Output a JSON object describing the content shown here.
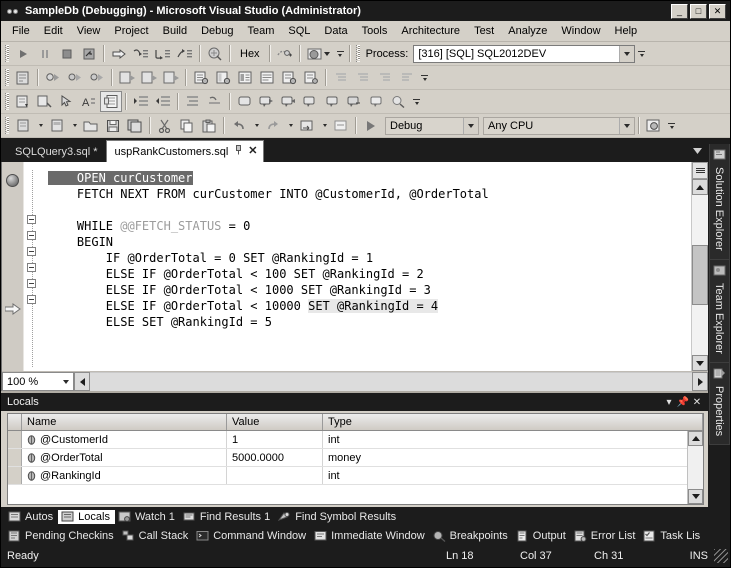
{
  "window": {
    "title": "SampleDb (Debugging) - Microsoft Visual Studio (Administrator)",
    "logo_icon": "vs-logo-icon",
    "minimize_label": "_",
    "maximize_label": "□",
    "close_label": "✕"
  },
  "menu": {
    "items": [
      {
        "label": "File"
      },
      {
        "label": "Edit"
      },
      {
        "label": "View"
      },
      {
        "label": "Project"
      },
      {
        "label": "Build"
      },
      {
        "label": "Debug"
      },
      {
        "label": "Team"
      },
      {
        "label": "SQL"
      },
      {
        "label": "Data"
      },
      {
        "label": "Tools"
      },
      {
        "label": "Architecture"
      },
      {
        "label": "Test"
      },
      {
        "label": "Analyze"
      },
      {
        "label": "Window"
      },
      {
        "label": "Help"
      }
    ]
  },
  "toolbars": {
    "debug": {
      "buttons": [
        {
          "name": "continue-button",
          "icon": "play-icon"
        },
        {
          "name": "break-all-button",
          "icon": "pause-icon"
        },
        {
          "name": "stop-debugging-button",
          "icon": "stop-icon"
        },
        {
          "name": "restart-button",
          "icon": "restart-icon"
        },
        {
          "name": "show-next-statement-button",
          "icon": "arrow-right-icon"
        },
        {
          "name": "step-into-button",
          "icon": "step-into-icon"
        },
        {
          "name": "step-over-button",
          "icon": "step-over-icon"
        },
        {
          "name": "step-out-button",
          "icon": "step-out-icon"
        },
        {
          "name": "breakpoints-window-button",
          "icon": "breakpoint-window-icon"
        }
      ],
      "hex_label": "Hex",
      "thread_icon": "thread-icon",
      "process_label": "Process:",
      "process_value": "[316] [SQL] SQL2012DEV"
    },
    "standard": {
      "config_value": "Debug",
      "platform_value": "Any CPU",
      "start_icon": "start-debug-icon"
    },
    "zoom_value": "100 %"
  },
  "doc_tabs": [
    {
      "label": "SQLQuery3.sql *",
      "active": false,
      "name": "tab-sqlquery3"
    },
    {
      "label": "uspRankCustomers.sql",
      "active": true,
      "name": "tab-usprankcustomers",
      "pin_icon": "pin-icon",
      "close_icon": "close-icon"
    }
  ],
  "editor": {
    "lines": [
      {
        "indent": 4,
        "segments": [
          {
            "text": "OPEN curCustomer",
            "style": "sel"
          }
        ]
      },
      {
        "indent": 4,
        "segments": [
          {
            "text": "FETCH NEXT FROM curCustomer INTO @CustomerId, @OrderTotal",
            "style": "plain"
          }
        ]
      },
      {
        "indent": 0,
        "segments": [
          {
            "text": "",
            "style": "plain"
          }
        ]
      },
      {
        "indent": 4,
        "segments": [
          {
            "text": "WHILE ",
            "style": "plain"
          },
          {
            "text": "@@FETCH_STATUS",
            "style": "sys"
          },
          {
            "text": " = 0",
            "style": "plain"
          }
        ]
      },
      {
        "indent": 4,
        "segments": [
          {
            "text": "BEGIN",
            "style": "plain"
          }
        ]
      },
      {
        "indent": 8,
        "segments": [
          {
            "text": "IF @OrderTotal = 0 SET @RankingId = 1",
            "style": "plain"
          }
        ]
      },
      {
        "indent": 8,
        "segments": [
          {
            "text": "ELSE IF @OrderTotal < 100 SET @RankingId = 2",
            "style": "plain"
          }
        ]
      },
      {
        "indent": 8,
        "segments": [
          {
            "text": "ELSE IF @OrderTotal < 1000 SET @RankingId = 3",
            "style": "plain"
          }
        ]
      },
      {
        "indent": 8,
        "segments": [
          {
            "text": "ELSE IF @OrderTotal < 10000 ",
            "style": "plain"
          },
          {
            "text": "SET @RankingId = 4",
            "style": "hl"
          }
        ]
      },
      {
        "indent": 8,
        "segments": [
          {
            "text": "ELSE SET @RankingId = 5",
            "style": "plain"
          }
        ]
      }
    ],
    "breakpoint_icon": "breakpoint-icon",
    "current_statement_icon": "current-statement-arrow-icon"
  },
  "right_tabs": [
    {
      "label": "Solution Explorer",
      "icon": "solution-explorer-icon",
      "name": "vtab-solution-explorer"
    },
    {
      "label": "Team Explorer",
      "icon": "team-explorer-icon",
      "name": "vtab-team-explorer"
    },
    {
      "label": "Properties",
      "icon": "properties-icon",
      "name": "vtab-properties"
    }
  ],
  "locals": {
    "title": "Locals",
    "dropdown_icon": "chevron-down-icon",
    "pin_icon": "pin-icon",
    "close_icon": "close-icon",
    "columns": [
      "Name",
      "Value",
      "Type"
    ],
    "rows": [
      {
        "name": "@CustomerId",
        "value": "1",
        "type": "int"
      },
      {
        "name": "@OrderTotal",
        "value": "5000.0000",
        "type": "money"
      },
      {
        "name": "@RankingId",
        "value": "",
        "type": "int"
      }
    ]
  },
  "bottom_tabs_upper": [
    {
      "label": "Autos",
      "icon": "autos-icon",
      "active": false,
      "name": "tab-autos"
    },
    {
      "label": "Locals",
      "icon": "locals-icon",
      "active": true,
      "name": "tab-locals"
    },
    {
      "label": "Watch 1",
      "icon": "watch-icon",
      "active": false,
      "name": "tab-watch-1"
    },
    {
      "label": "Find Results 1",
      "icon": "find-results-icon",
      "active": false,
      "name": "tab-find-results-1"
    },
    {
      "label": "Find Symbol Results",
      "icon": "find-symbol-icon",
      "active": false,
      "name": "tab-find-symbol-results"
    }
  ],
  "bottom_tabs_lower": [
    {
      "label": "Pending Checkins",
      "icon": "pending-checkins-icon",
      "name": "tab-pending-checkins"
    },
    {
      "label": "Call Stack",
      "icon": "call-stack-icon",
      "name": "tab-call-stack"
    },
    {
      "label": "Command Window",
      "icon": "command-window-icon",
      "name": "tab-command-window"
    },
    {
      "label": "Immediate Window",
      "icon": "immediate-window-icon",
      "name": "tab-immediate-window"
    },
    {
      "label": "Breakpoints",
      "icon": "breakpoints-icon",
      "name": "tab-breakpoints"
    },
    {
      "label": "Output",
      "icon": "output-icon",
      "name": "tab-output"
    },
    {
      "label": "Error List",
      "icon": "error-list-icon",
      "name": "tab-error-list"
    },
    {
      "label": "Task Lis",
      "icon": "task-list-icon",
      "name": "tab-task-list"
    }
  ],
  "statusbar": {
    "status": "Ready",
    "line": "Ln 18",
    "col": "Col 37",
    "ch": "Ch 31",
    "insert_mode": "INS"
  },
  "colors": {
    "chrome": "#d4d0c8",
    "dark": "#1c1c1c",
    "editor_bg": "#ffffff",
    "selection": "#6a6a6a",
    "highlight": "#e8e8e8"
  }
}
